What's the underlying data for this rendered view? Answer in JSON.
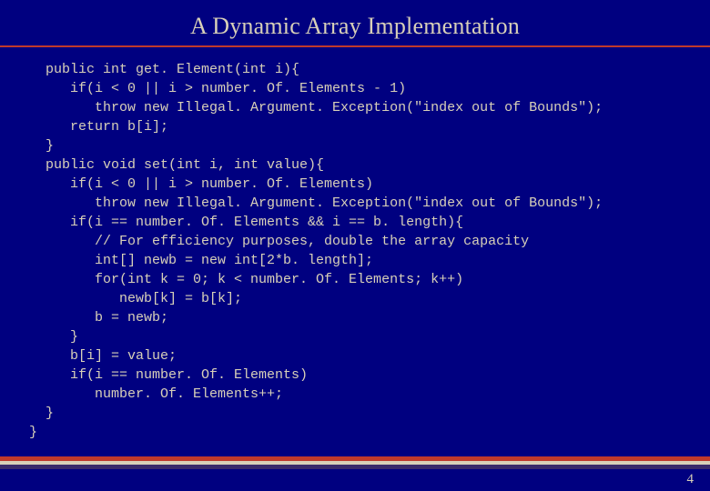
{
  "title": "A Dynamic Array Implementation",
  "code": {
    "l01": "  public int get. Element(int i){",
    "l02": "     if(i < 0 || i > number. Of. Elements - 1)",
    "l03": "        throw new Illegal. Argument. Exception(\"index out of Bounds\");",
    "l04": "     return b[i];",
    "l05": "  }",
    "l06": "  public void set(int i, int value){",
    "l07": "     if(i < 0 || i > number. Of. Elements)",
    "l08": "        throw new Illegal. Argument. Exception(\"index out of Bounds\");",
    "l09": "     if(i == number. Of. Elements && i == b. length){",
    "l10": "        // For efficiency purposes, double the array capacity",
    "l11": "        int[] newb = new int[2*b. length];",
    "l12": "        for(int k = 0; k < number. Of. Elements; k++)",
    "l13": "           newb[k] = b[k];",
    "l14": "        b = newb;",
    "l15": "     }",
    "l16": "     b[i] = value;",
    "l17": "     if(i == number. Of. Elements)",
    "l18": "        number. Of. Elements++;",
    "l19": "  }",
    "l20": "}"
  },
  "page_number": "4"
}
